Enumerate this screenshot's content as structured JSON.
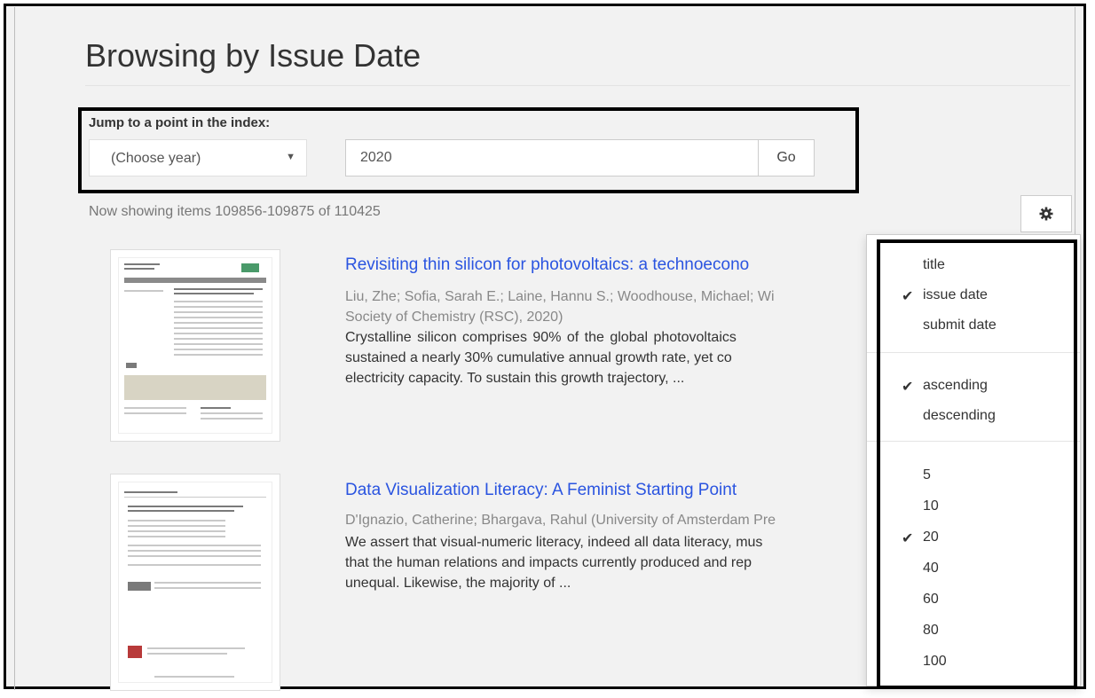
{
  "page": {
    "title": "Browsing by Issue Date"
  },
  "jump": {
    "label": "Jump to a point in the index:",
    "year_select_value": "(Choose year)",
    "year_input_value": "2020",
    "go_label": "Go"
  },
  "results": {
    "showing_text": "Now showing items 109856-109875 of 110425",
    "settings_icon": "gear-icon"
  },
  "items": [
    {
      "title": "Revisiting thin silicon for photovoltaics: a technoecono",
      "meta_line1": "Liu, Zhe; Sofia, Sarah E.; Laine, Hannu S.; Woodhouse, Michael; Wi",
      "meta_line2": "Society of Chemistry (RSC), 2020)",
      "abstract_line1": "Crystalline  silicon  comprises  90%  of  the  global  photovoltaics",
      "abstract_line2": "sustained a nearly 30% cumulative annual growth rate, yet co",
      "abstract_line3": "electricity capacity. To sustain this growth trajectory, ..."
    },
    {
      "title": "Data Visualization Literacy: A Feminist Starting Point",
      "meta_line1": "D'Ignazio, Catherine; Bhargava, Rahul (University of Amsterdam Pre",
      "abstract_line1": "We assert that visual-numeric literacy, indeed all data literacy, mus",
      "abstract_line2": "that the human relations and impacts currently produced and rep",
      "abstract_line3": "unequal. Likewise, the majority of ..."
    }
  ],
  "sort_menu": {
    "sort_by": [
      {
        "label": "title",
        "checked": false
      },
      {
        "label": "issue date",
        "checked": true
      },
      {
        "label": "submit date",
        "checked": false
      }
    ],
    "order": [
      {
        "label": "ascending",
        "checked": true
      },
      {
        "label": "descending",
        "checked": false
      }
    ],
    "rpp": [
      {
        "label": "5",
        "checked": false
      },
      {
        "label": "10",
        "checked": false
      },
      {
        "label": "20",
        "checked": true
      },
      {
        "label": "40",
        "checked": false
      },
      {
        "label": "60",
        "checked": false
      },
      {
        "label": "80",
        "checked": false
      },
      {
        "label": "100",
        "checked": false
      }
    ],
    "check_glyph": "✔"
  },
  "colors": {
    "link": "#2a54e0",
    "highlight_border": "#000000"
  }
}
